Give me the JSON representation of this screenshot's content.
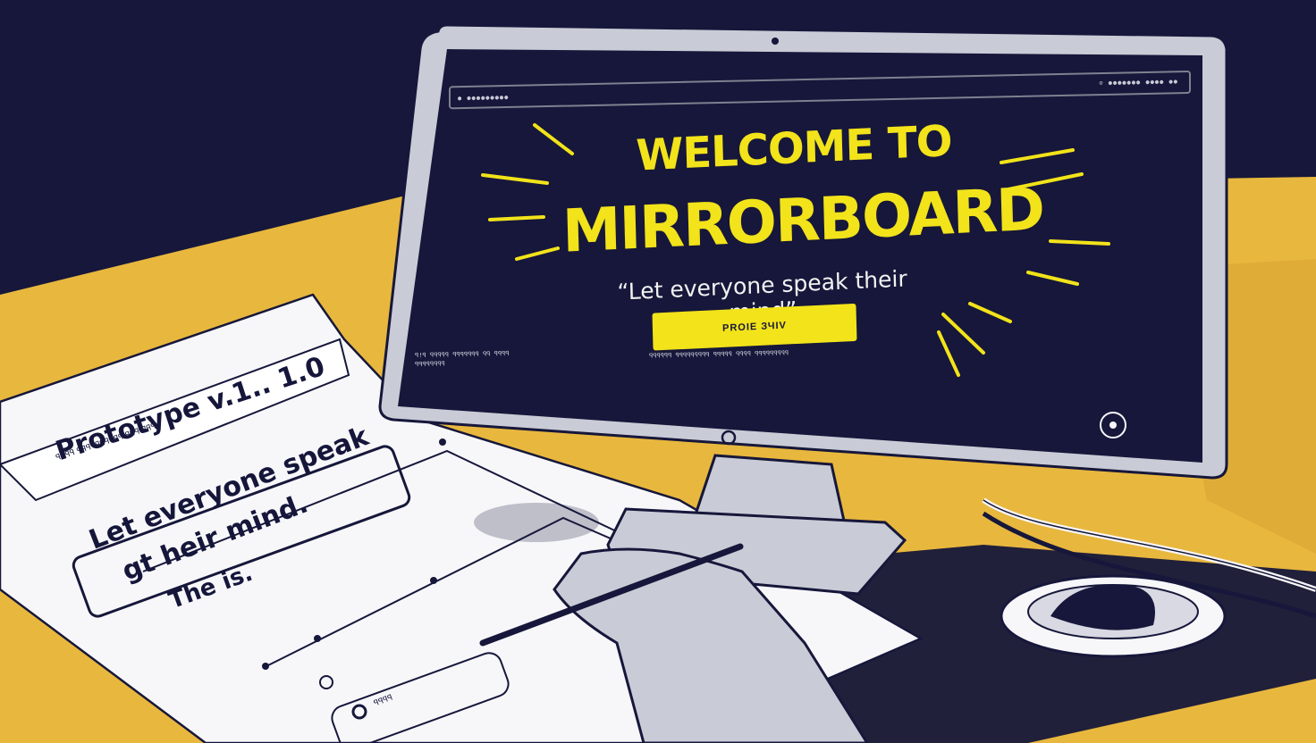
{
  "monitor": {
    "browser_url": "● ●●●●●●●●●",
    "browser_controls": "⊙ ●●●●●●●  ●●●●  ●●",
    "title_line1": "WELCOME TO",
    "title_line2": "MIRRORBOARD",
    "tagline": "“Let everyone speak their mind”",
    "cta_label": "PROIE ЗЧIV",
    "small_text_left": "ꟼ!ꟼ ꟼꟼꟼꟼꟼ ꟼꟼꟼꟼꟼꟼꟼ ꟼꟼ ꟼꟼꟼꟼ ꟼꟼꟼꟼꟼꟼꟼꟼ",
    "small_text_mid": "ꟼꟼꟼꟼꟼꟼ ꟼꟼꟼꟼꟼꟼꟼꟼꟼ ꟼꟼꟼꟼꟼ ꟼꟼꟼꟼ ꟼꟼꟼꟼꟼꟼꟼꟼꟼ"
  },
  "paper": {
    "header_small": "ꟼꟼꟼꟼ ꟼꟼꟼꟼꟼꟼꟼꟼꟼꟼ ꟼꟼꟼ ꟼꟼꟼ.",
    "title": "Prototype v.1.. 1.0",
    "quote_line1": "Let everyone speak",
    "quote_line2": "gt heir mind.",
    "subheading": "The is.",
    "footer_label": "ꟼꟼꟼꟼ"
  },
  "colors": {
    "navy": "#16173a",
    "yellow": "#f2e31a",
    "desk": "#e8b73e",
    "bezel": "#c9cbd6",
    "paper": "#f7f7fa"
  }
}
